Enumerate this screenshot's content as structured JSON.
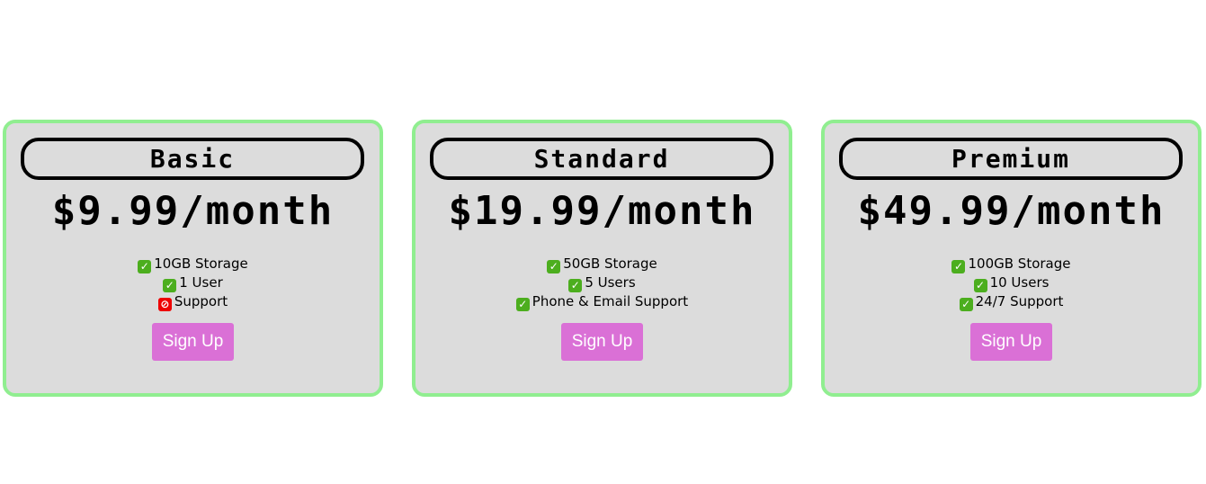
{
  "plans": [
    {
      "name": "Basic",
      "price": "$9.99/month",
      "features": [
        {
          "icon": "check-icon",
          "text": "10GB Storage"
        },
        {
          "icon": "check-icon",
          "text": "1 User"
        },
        {
          "icon": "prohibited-icon",
          "text": "Support"
        }
      ],
      "button": "Sign Up"
    },
    {
      "name": "Standard",
      "price": "$19.99/month",
      "features": [
        {
          "icon": "check-icon",
          "text": "50GB Storage"
        },
        {
          "icon": "check-icon",
          "text": "5 Users"
        },
        {
          "icon": "check-icon",
          "text": "Phone & Email Support"
        }
      ],
      "button": "Sign Up"
    },
    {
      "name": "Premium",
      "price": "$49.99/month",
      "features": [
        {
          "icon": "check-icon",
          "text": "100GB Storage"
        },
        {
          "icon": "check-icon",
          "text": "10 Users"
        },
        {
          "icon": "check-icon",
          "text": "24/7 Support"
        }
      ],
      "button": "Sign Up"
    }
  ],
  "colors": {
    "card_border": "#90EE90",
    "card_bg": "#dcdcdc",
    "button": "#DA70D6",
    "check": "#4cae1e",
    "cross": "#ee0000"
  }
}
